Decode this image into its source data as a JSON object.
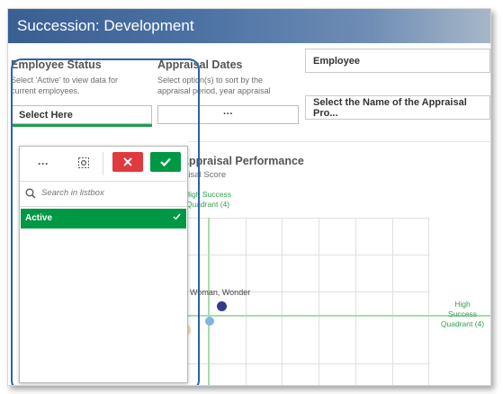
{
  "app": {
    "title": "Succession: Development"
  },
  "filters": {
    "employee_status": {
      "label": "Employee Status",
      "description_line1": "Select 'Active' to view data for",
      "description_line2": "current employees.",
      "button_label": "Select Here"
    },
    "appraisal_dates": {
      "label": "Appraisal Dates",
      "description_line1": "Select option(s) to sort by the",
      "description_line2": "appraisal period, year appraisal",
      "button_label": "···"
    },
    "employee": {
      "label": "Employee"
    },
    "appraisal_program": {
      "label": "Select the Name of the Appraisal Pro..."
    }
  },
  "listbox": {
    "more_label": "···",
    "search_placeholder": "Search in listbox",
    "items": [
      {
        "label": "Active",
        "selected": true
      }
    ],
    "colors": {
      "selected": "#009845",
      "cancel": "#e0393e",
      "confirm": "#009845"
    }
  },
  "chart": {
    "title": "Appraisal Performance",
    "subtitle": "raisal Score",
    "quadrant_top": {
      "line1": "High Success",
      "line2": "Quadrant (4)"
    },
    "quadrant_right": {
      "line1": "High",
      "line2": "Success",
      "line3": "Quadrant (4)"
    },
    "point_label": "Woman, Wonder",
    "partial_axis_char": "e",
    "colors": {
      "accent_line": "#a8dcae",
      "label": "#2fa34b",
      "point_dark": "#303c8a",
      "point_light": "#7fb5e6",
      "point_tan": "#f0dbb2"
    }
  }
}
